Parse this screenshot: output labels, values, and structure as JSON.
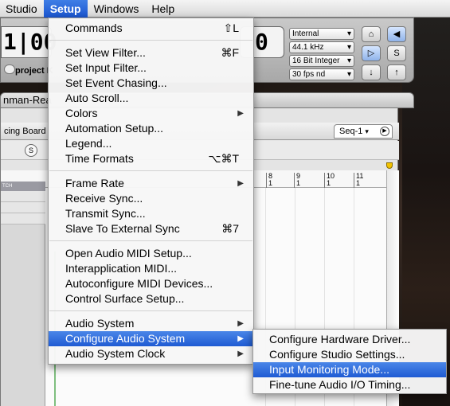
{
  "menubar": {
    "items": [
      "Studio",
      "Setup",
      "Windows",
      "Help"
    ]
  },
  "transport": {
    "counter_left": "1|00",
    "counter_right": "0",
    "project_label": "project K",
    "selects": [
      "Internal",
      "44.1 kHz",
      "16 Bit Integer",
      "30 fps nd"
    ],
    "btn_s": "S"
  },
  "window": {
    "title": "nman-Rea",
    "left_tab": "cing Board",
    "seq_tab": "Seq-1",
    "s_button": "S",
    "track_header": "TCH",
    "ruler_marks": [
      {
        "bar": "8",
        "beat": "1"
      },
      {
        "bar": "9",
        "beat": "1"
      },
      {
        "bar": "10",
        "beat": "1"
      },
      {
        "bar": "11",
        "beat": "1"
      }
    ]
  },
  "setup_menu": {
    "items": [
      {
        "label": "Commands",
        "shortcut": "⇧L"
      },
      {
        "sep": true
      },
      {
        "label": "Set View Filter...",
        "shortcut": "⌘F"
      },
      {
        "label": "Set Input Filter...",
        "shortcut": ""
      },
      {
        "label": "Set Event Chasing...",
        "shortcut": ""
      },
      {
        "label": "Auto Scroll...",
        "shortcut": ""
      },
      {
        "label": "Colors",
        "submenu": true
      },
      {
        "label": "Automation Setup...",
        "shortcut": ""
      },
      {
        "label": "Legend...",
        "shortcut": ""
      },
      {
        "label": "Time Formats",
        "shortcut": "⌥⌘T"
      },
      {
        "sep": true
      },
      {
        "label": "Frame Rate",
        "submenu": true
      },
      {
        "label": "Receive Sync...",
        "shortcut": ""
      },
      {
        "label": "Transmit Sync...",
        "shortcut": ""
      },
      {
        "label": "Slave To External Sync",
        "shortcut": "⌘7"
      },
      {
        "sep": true
      },
      {
        "label": "Open Audio MIDI Setup...",
        "shortcut": ""
      },
      {
        "label": "Interapplication MIDI...",
        "shortcut": ""
      },
      {
        "label": "Autoconfigure MIDI Devices...",
        "shortcut": ""
      },
      {
        "label": "Control Surface Setup...",
        "shortcut": ""
      },
      {
        "sep": true
      },
      {
        "label": "Audio System",
        "submenu": true
      },
      {
        "label": "Configure Audio System",
        "submenu": true,
        "highlighted": true
      },
      {
        "label": "Audio System Clock",
        "submenu": true
      }
    ]
  },
  "submenu": {
    "items": [
      {
        "label": "Configure Hardware Driver..."
      },
      {
        "label": "Configure Studio Settings..."
      },
      {
        "label": "Input Monitoring Mode...",
        "highlighted": true
      },
      {
        "label": "Fine-tune Audio I/O Timing..."
      }
    ]
  }
}
